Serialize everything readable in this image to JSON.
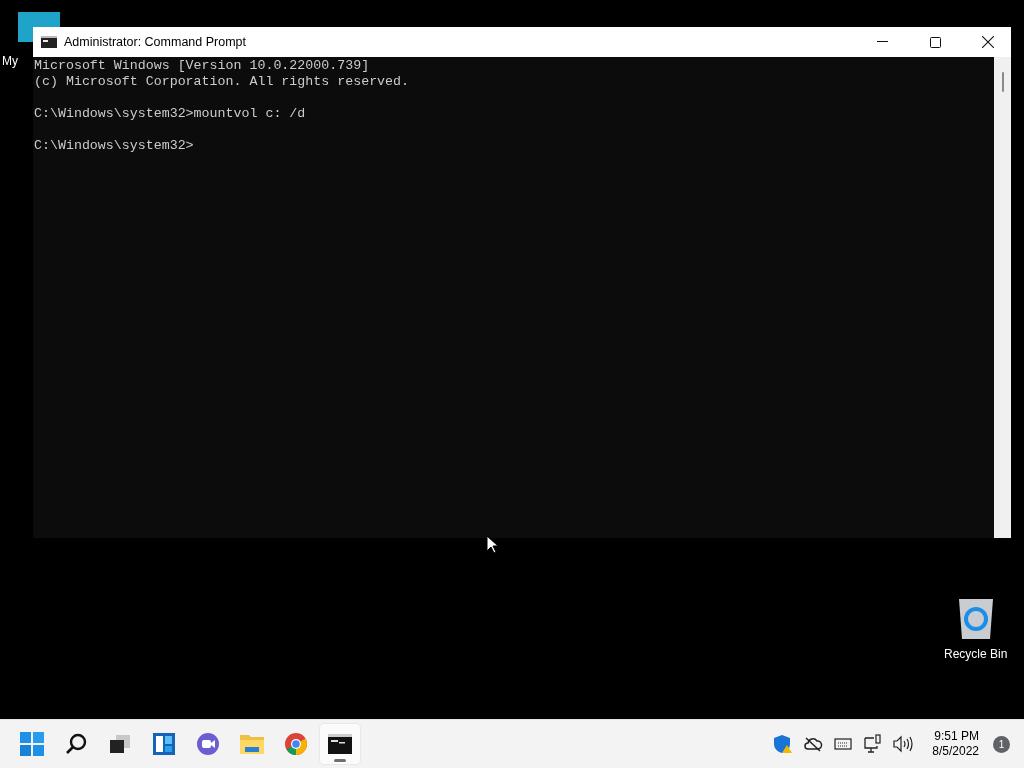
{
  "desktop_icons": [
    {
      "label": "My",
      "kind": "computer"
    },
    {
      "label": "Recycle Bin",
      "kind": "bin"
    }
  ],
  "window": {
    "title": "Administrator: Command Prompt",
    "console_blocks": [
      [
        "Microsoft Windows [Version 10.0.22000.739]",
        "(c) Microsoft Corporation. All rights reserved."
      ],
      [
        "C:\\Windows\\system32>mountvol c: /d"
      ],
      [
        "C:\\Windows\\system32>"
      ]
    ]
  },
  "taskbar": {
    "apps": [
      {
        "kind": "start",
        "selected": false
      },
      {
        "kind": "search",
        "selected": false
      },
      {
        "kind": "taskview",
        "selected": false
      },
      {
        "kind": "widgets",
        "selected": false
      },
      {
        "kind": "chat",
        "selected": false
      },
      {
        "kind": "explorer",
        "selected": false
      },
      {
        "kind": "chrome",
        "selected": false
      },
      {
        "kind": "terminal",
        "selected": true
      }
    ],
    "tray": {
      "time": "9:51 PM",
      "date": "8/5/2022",
      "notifications": "1"
    }
  }
}
